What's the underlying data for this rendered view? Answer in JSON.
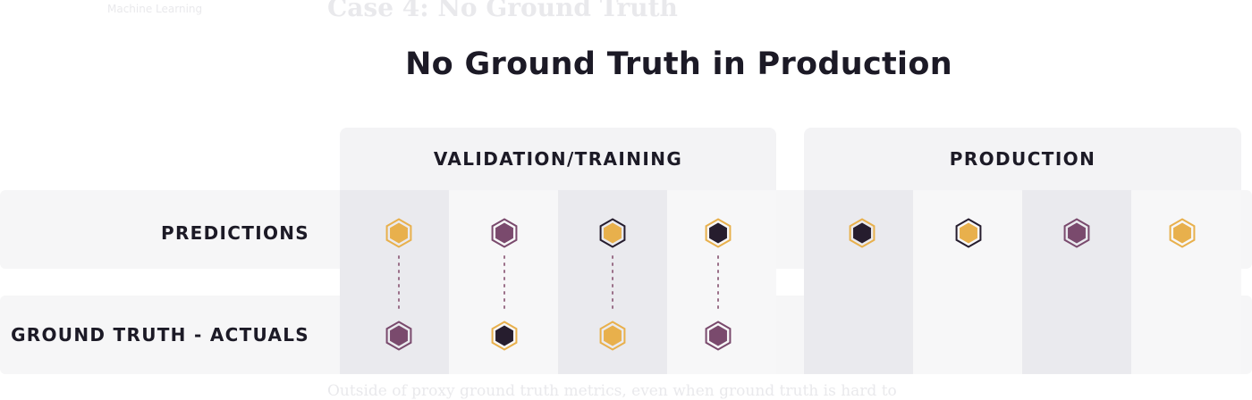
{
  "background_text": {
    "nav": "Machine Learning",
    "heading": "Case 4: No Ground Truth",
    "paragraph": "Outside of proxy ground truth metrics, even when ground truth is hard to"
  },
  "title": "No Ground Truth in Production",
  "sections": {
    "validation": "VALIDATION/TRAINING",
    "production": "PRODUCTION"
  },
  "rows": {
    "predictions": "PREDICTIONS",
    "actuals": "GROUND TRUTH - ACTUALS"
  },
  "colors": {
    "purple": "#7a4a6d",
    "gold": "#e8b04c",
    "dark": "#261d2e",
    "connector": "#9b7089"
  },
  "markers": {
    "validation_predictions": [
      "gold",
      "purple",
      "gold-dark-ring",
      "dark"
    ],
    "validation_actuals": [
      "purple",
      "dark",
      "gold",
      "purple"
    ],
    "production_predictions": [
      "dark",
      "gold-dark-ring",
      "purple",
      "gold"
    ],
    "production_actuals": []
  }
}
